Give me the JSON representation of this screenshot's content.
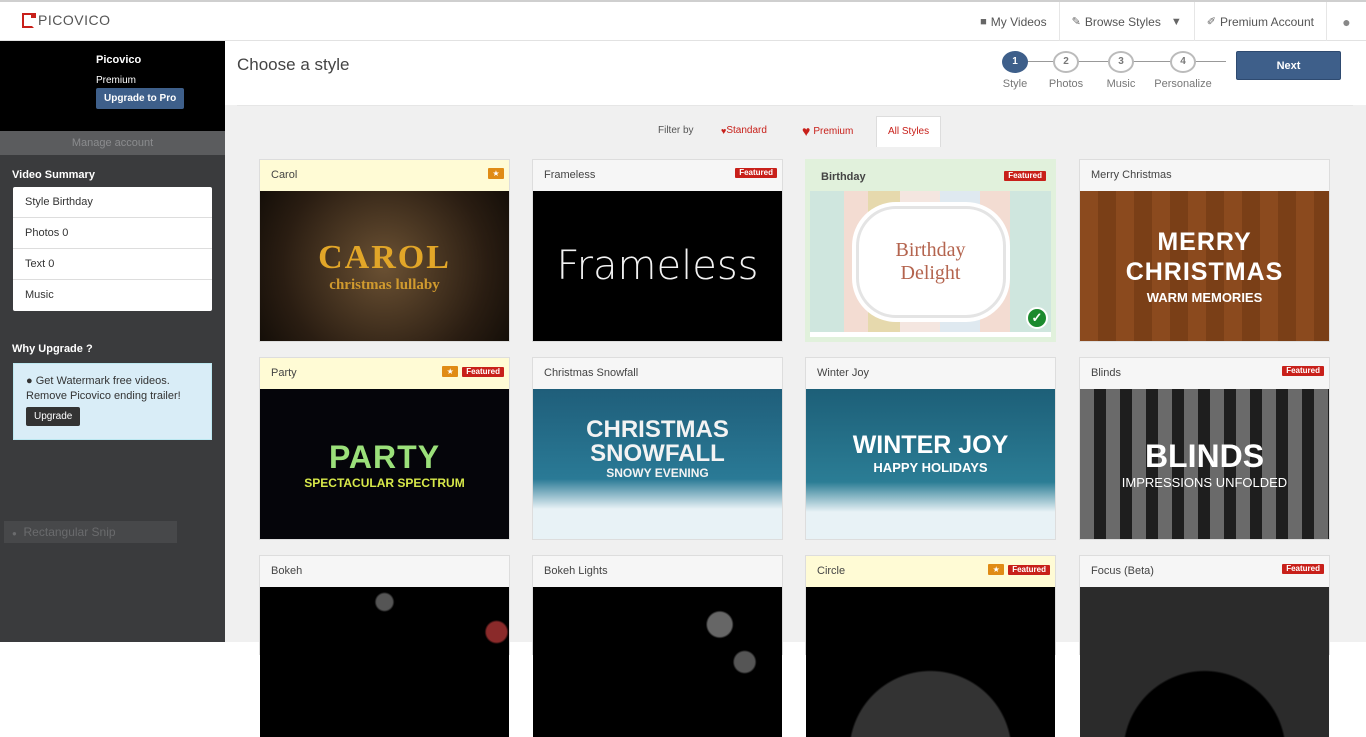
{
  "app": {
    "name": "PICOVICO"
  },
  "nav": {
    "my_videos": "My Videos",
    "browse_styles": "Browse Styles",
    "premium_account": "Premium Account"
  },
  "sidebar": {
    "account_name": "Picovico",
    "plan": "Premium",
    "upgrade_label": "Upgrade to Pro",
    "manage_label": "Manage account",
    "summary_heading": "Video Summary",
    "summary": [
      "Style Birthday",
      "Photos 0",
      "Text 0",
      "Music"
    ],
    "why_heading": "Why Upgrade ?",
    "why_text": "Get Watermark free videos. Remove Picovico ending trailer!",
    "why_button": "Upgrade",
    "snip_label": "Rectangular Snip"
  },
  "main": {
    "title": "Choose a style",
    "steps": [
      {
        "n": "1",
        "label": "Style"
      },
      {
        "n": "2",
        "label": "Photos"
      },
      {
        "n": "3",
        "label": "Music"
      },
      {
        "n": "4",
        "label": "Personalize"
      }
    ],
    "active_step": 1,
    "next_label": "Next",
    "filter": {
      "label": "Filter by",
      "standard": "Standard",
      "premium": "Premium",
      "all": "All Styles"
    }
  },
  "badges": {
    "featured": "Featured"
  },
  "styles": [
    {
      "name": "Carol",
      "premium": true,
      "featured": false,
      "thumb_line1": "CAROL",
      "thumb_line2": "christmas lullaby"
    },
    {
      "name": "Frameless",
      "premium": false,
      "featured": true,
      "thumb_line1": "Frameless",
      "thumb_line2": ""
    },
    {
      "name": "Birthday",
      "premium": false,
      "featured": true,
      "selected": true,
      "thumb_line1": "Birthday",
      "thumb_line2": "Delight"
    },
    {
      "name": "Merry Christmas",
      "premium": false,
      "featured": false,
      "thumb_line1": "MERRY",
      "thumb_line2": "CHRISTMAS",
      "thumb_line3": "WARM MEMORIES"
    },
    {
      "name": "Party",
      "premium": true,
      "featured": true,
      "thumb_line1": "PARTY",
      "thumb_line2": "SPECTACULAR SPECTRUM"
    },
    {
      "name": "Christmas Snowfall",
      "premium": false,
      "featured": false,
      "thumb_line1": "CHRISTMAS",
      "thumb_line2": "SNOWFALL",
      "thumb_line3": "SNOWY EVENING"
    },
    {
      "name": "Winter Joy",
      "premium": false,
      "featured": false,
      "thumb_line1": "WINTER JOY",
      "thumb_line2": "HAPPY HOLIDAYS"
    },
    {
      "name": "Blinds",
      "premium": false,
      "featured": true,
      "thumb_line1": "BLINDS",
      "thumb_line2": "IMPRESSIONS UNFOLDED"
    },
    {
      "name": "Bokeh",
      "premium": false,
      "featured": false
    },
    {
      "name": "Bokeh Lights",
      "premium": false,
      "featured": false
    },
    {
      "name": "Circle",
      "premium": true,
      "featured": true
    },
    {
      "name": "Focus (Beta)",
      "premium": false,
      "featured": true
    }
  ],
  "colors": {
    "accent": "#3e5f8a",
    "brand_red": "#c8201a",
    "premium_header": "#fffbd5",
    "selected_header": "#e1f1dc",
    "star_badge": "#e08b15"
  }
}
